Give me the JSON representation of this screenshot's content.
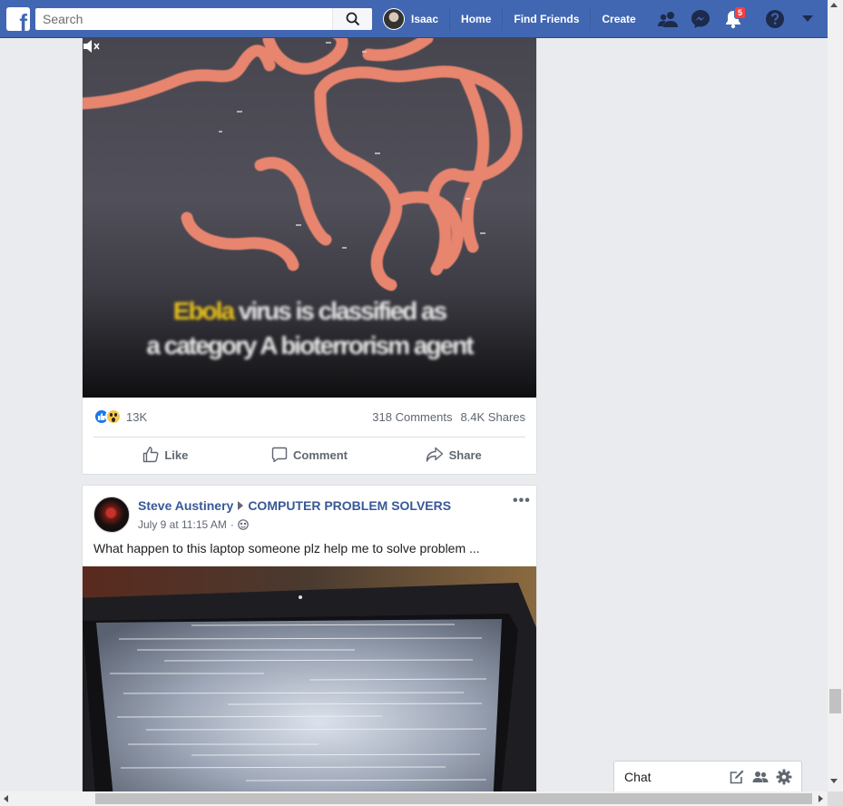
{
  "topbar": {
    "search_placeholder": "Search",
    "profile_name": "Isaac",
    "nav_links": [
      "Home",
      "Find Friends",
      "Create"
    ],
    "notification_count": "5",
    "brand_color": "#4267b2"
  },
  "post1": {
    "video_caption_highlight": "Ebola",
    "video_caption_line1_rest": " virus is classified as",
    "video_caption_line2": "a category A bioterrorism agent",
    "reaction_count": "13K",
    "comments": "318 Comments",
    "shares": "8.4K Shares",
    "actions": {
      "like": "Like",
      "comment": "Comment",
      "share": "Share"
    }
  },
  "post2": {
    "author": "Steve Austinery",
    "group": "COMPUTER PROBLEM SOLVERS",
    "timestamp": "July 9 at 11:15 AM",
    "separator": "·",
    "more": "•••",
    "text": "What happen to this laptop someone plz help me to solve problem ..."
  },
  "chat": {
    "label": "Chat"
  },
  "icons": [
    "facebook-logo-icon",
    "search-icon",
    "friends-icon",
    "messenger-icon",
    "bell-icon",
    "help-icon",
    "caret-down-icon",
    "mute-icon",
    "like-icon",
    "comment-icon",
    "share-icon",
    "globe-icon",
    "compose-icon",
    "group-icon",
    "gear-icon"
  ]
}
